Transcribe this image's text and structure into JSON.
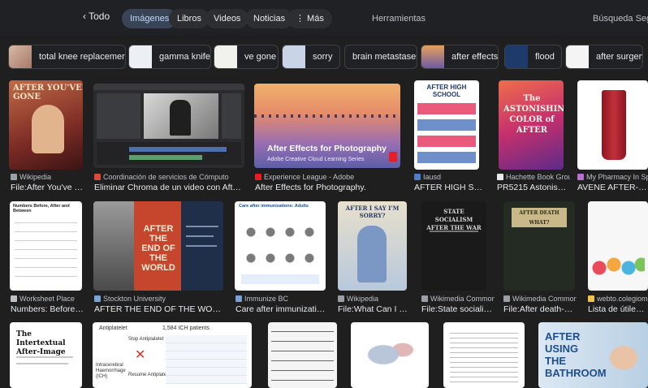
{
  "filters": {
    "back": "‹ Todo",
    "items": [
      {
        "label": "Imágenes",
        "active": true
      },
      {
        "label": "Libros",
        "active": false
      },
      {
        "label": "Videos",
        "active": false
      },
      {
        "label": "Noticias",
        "active": false
      },
      {
        "label": "⋮ Más",
        "active": false
      }
    ],
    "tools": "Herramientas",
    "safe_search": "Búsqueda Segura"
  },
  "chips": [
    {
      "label": "total knee replacement"
    },
    {
      "label": "gamma knife"
    },
    {
      "label": "ve gone"
    },
    {
      "label": "sorry"
    },
    {
      "label": "brain metastases"
    },
    {
      "label": "after effects"
    },
    {
      "label": "flood"
    },
    {
      "label": "after surgery"
    }
  ],
  "row1": [
    {
      "source": "Wikipedia",
      "caption": "File:After You've Go...",
      "img_text": "AFTER YOU'VE GONE"
    },
    {
      "source": "Coordinación de servicios de Cómputo",
      "caption": "Eliminar Chroma de un video con After Effe..."
    },
    {
      "source": "Experience League - Adobe",
      "caption": "After Effects for Photography.",
      "img_text": "After Effects for Photography",
      "img_sub": "Adobe Creative Cloud Learning Series"
    },
    {
      "source": "Iausd",
      "caption": "AFTER HIGH SCHO...",
      "img_text": "AFTER HIGH SCHOOL"
    },
    {
      "source": "Hachette Book Group",
      "caption": "PR5215 Astonishin...",
      "img_text": "The ASTONISHING COLOR of AFTER"
    },
    {
      "source": "My Pharmacy In Spain",
      "caption": "AVENE AFTER-SHAVE"
    }
  ],
  "row2": [
    {
      "source": "Worksheet Place",
      "caption": "Numbers: Before, A...",
      "img_text": "Numbers Before, After and Between"
    },
    {
      "source": "Stockton University",
      "caption": "AFTER THE END OF THE WORLD",
      "img_text": "AFTER THE END OF THE WORLD"
    },
    {
      "source": "Immunize BC",
      "caption": "Care after immunization: ...",
      "img_text": "Care after immunizations: Adults"
    },
    {
      "source": "Wikipedia",
      "caption": "File:What Can I Say ...",
      "img_text": "AFTER I SAY I'M SORRY?"
    },
    {
      "source": "Wikimedia Commons",
      "caption": "File:State socialism...",
      "img_text": "STATE SOCIALISM AFTER THE WAR"
    },
    {
      "source": "Wikimedia Commons",
      "caption": "File:After death-wh...",
      "img_text": "AFTER DEATH WHAT?"
    },
    {
      "source": "webto.colegiomsyd",
      "caption": "Lista de útiles Afte..."
    }
  ],
  "row3": [
    {
      "img_text": "The Intertextual After-Image"
    },
    {
      "img_text": "Antiplatelet",
      "img_sub": "Stop Antiplatelet",
      "img_sub2": "Intracerebral Haemorrhage (ICH)",
      "img_sub3": "Resume Antiplatelet"
    },
    {
      "img_text": "1,584 ICH patients"
    },
    {
      "img_text": ""
    },
    {
      "img_text": ""
    },
    {
      "img_text": ""
    },
    {
      "img_text": "AFTER USING THE BATHROOM"
    }
  ],
  "colors": {
    "background": "#1f1f1f",
    "active_pill": "#394457",
    "text": "#e8eaed",
    "muted": "#bdc1c6"
  }
}
